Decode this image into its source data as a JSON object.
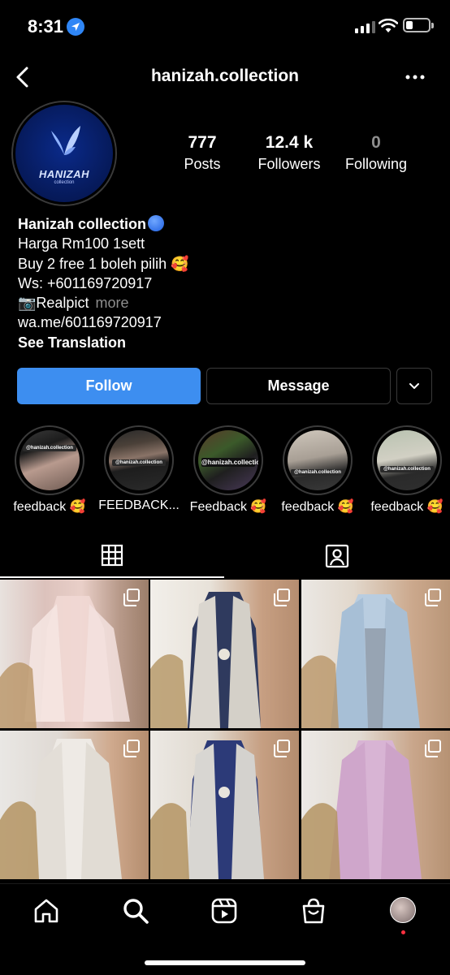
{
  "status": {
    "time": "8:31"
  },
  "header": {
    "username": "hanizah.collection"
  },
  "avatar": {
    "brand": "HANIZAH",
    "sub": "collection"
  },
  "stats": [
    {
      "value": "777",
      "label": "Posts"
    },
    {
      "value": "12.4 k",
      "label": "Followers"
    },
    {
      "value": "0",
      "label": "Following"
    }
  ],
  "bio": {
    "name": "Hanizah collection",
    "line1": "Harga Rm100 1sett",
    "line2": "Buy 2 free 1 boleh pilih 🥰",
    "line3": "Ws: +601169720917",
    "line4": "📷Realpict",
    "more": "more",
    "link": "wa.me/601169720917",
    "translation": "See Translation"
  },
  "buttons": {
    "follow": "Follow",
    "message": "Message"
  },
  "highlights": [
    {
      "label": "feedback 🥰",
      "tag": "@hanizah.collection"
    },
    {
      "label": "FEEDBACK...",
      "tag": "@hanizah.collection"
    },
    {
      "label": "Feedback 🥰",
      "tag": "@hanizah.collection"
    },
    {
      "label": "feedback 🥰",
      "tag": "@hanizah.collection"
    },
    {
      "label": "feedback 🥰",
      "tag": "@hanizah.collection"
    }
  ],
  "colors": {
    "accent": "#3d8ef0",
    "posts": [
      "#d9b5ae",
      "#2a3350",
      "#a9bccc",
      "#d9d3cd",
      "#2c3a78",
      "#c8a2c4"
    ]
  }
}
